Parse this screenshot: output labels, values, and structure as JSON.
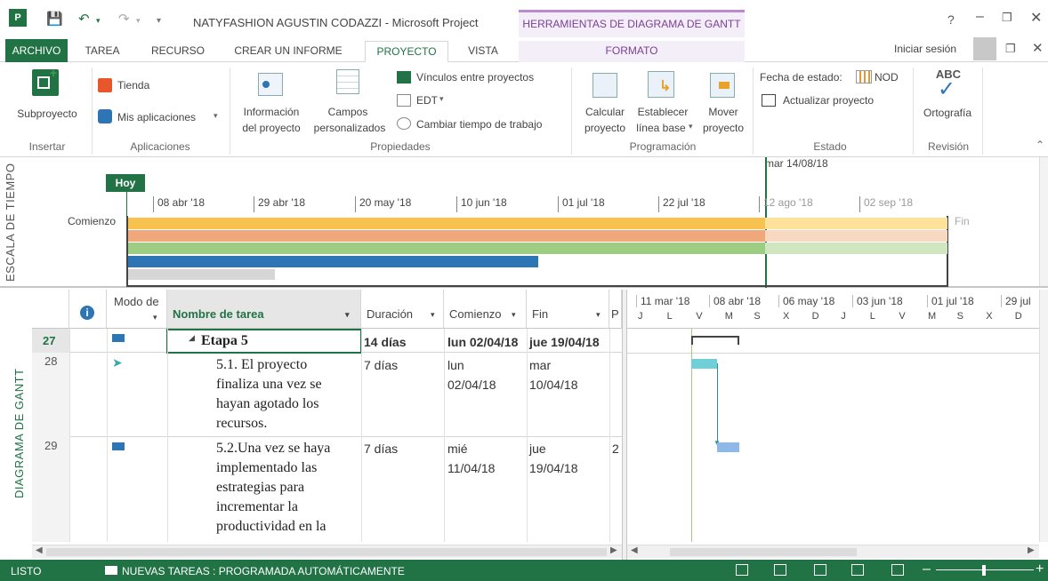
{
  "title": {
    "app": "NATYFASHION AGUSTIN CODAZZI - Microsoft Project",
    "context": "HERRAMIENTAS DE DIAGRAMA DE GANTT",
    "help": "?",
    "signin": "Iniciar sesión"
  },
  "tabs": [
    "ARCHIVO",
    "TAREA",
    "RECURSO",
    "CREAR UN INFORME",
    "PROYECTO",
    "VISTA",
    "FORMATO"
  ],
  "ribbon": {
    "insert": {
      "sub": "Subproyecto",
      "group": "Insertar"
    },
    "apps": {
      "store": "Tienda",
      "myapps": "Mis aplicaciones",
      "group": "Aplicaciones"
    },
    "props": {
      "info1": "Información",
      "info2": "del proyecto",
      "fields1": "Campos",
      "fields2": "personalizados",
      "links": "Vínculos entre proyectos",
      "wbs": "EDT",
      "worktime": "Cambiar tiempo de trabajo",
      "group": "Propiedades"
    },
    "sched": {
      "calc1": "Calcular",
      "calc2": "proyecto",
      "base1": "Establecer",
      "base2": "línea base",
      "move1": "Mover",
      "move2": "proyecto",
      "group": "Programación"
    },
    "status": {
      "date": "Fecha de estado:",
      "nod": "NOD",
      "update": "Actualizar proyecto",
      "group": "Estado"
    },
    "review": {
      "abc": "ABC",
      "spell": "Ortografía",
      "group": "Revisión"
    }
  },
  "timescale": {
    "label": "ESCALA DE TIEMPO",
    "today": "Hoy",
    "start": "Comienzo",
    "end": "Fin",
    "marker": "mar 14/08/18",
    "dates": [
      "08 abr '18",
      "29 abr '18",
      "20 may '18",
      "10 jun '18",
      "01 jul '18",
      "22 jul '18",
      "12 ago '18",
      "02 sep '18"
    ]
  },
  "grid": {
    "side_label": "DIAGRAMA DE GANTT",
    "headers": {
      "mode": "Modo de",
      "name": "Nombre de tarea",
      "duration": "Duración",
      "start": "Comienzo",
      "finish": "Fin",
      "pred": "P"
    },
    "rows": [
      {
        "id": "27",
        "name": "Etapa 5",
        "duration": "14 días",
        "start": "lun 02/04/18",
        "finish": "jue 19/04/18",
        "pred": ""
      },
      {
        "id": "28",
        "name": "5.1. El proyecto finaliza una vez se hayan agotado los recursos.",
        "name_lines": [
          "5.1. El proyecto",
          "finaliza una vez se",
          "hayan agotado los",
          "recursos."
        ],
        "duration": "7 días",
        "start_lines": [
          "lun",
          "02/04/18"
        ],
        "finish_lines": [
          "mar",
          "10/04/18"
        ],
        "pred": ""
      },
      {
        "id": "29",
        "name": "5.2.Una vez se haya implementado las estrategias para incrementar la productividad en la",
        "name_lines": [
          "5.2.Una vez se haya",
          "implementado las",
          "estrategias para",
          "incrementar la",
          "productividad en la"
        ],
        "duration": "7 días",
        "start_lines": [
          "mié",
          "11/04/18"
        ],
        "finish_lines": [
          "jue",
          "19/04/18"
        ],
        "pred": "2"
      }
    ]
  },
  "gantt": {
    "months": [
      "11 mar '18",
      "08 abr '18",
      "06 may '18",
      "03 jun '18",
      "01 jul '18",
      "29 jul"
    ],
    "days": [
      "J",
      "L",
      "V",
      "M",
      "S",
      "X",
      "D",
      "J",
      "L",
      "V",
      "M",
      "S",
      "X",
      "D"
    ]
  },
  "statusbar": {
    "ready": "LISTO",
    "newtasks": "NUEVAS TAREAS : PROGRAMADA AUTOMÁTICAMENTE"
  },
  "colors": {
    "accent": "#217346",
    "context": "#7b3f98",
    "bar": "#6fd0d8",
    "bar2": "#8db8e8"
  }
}
